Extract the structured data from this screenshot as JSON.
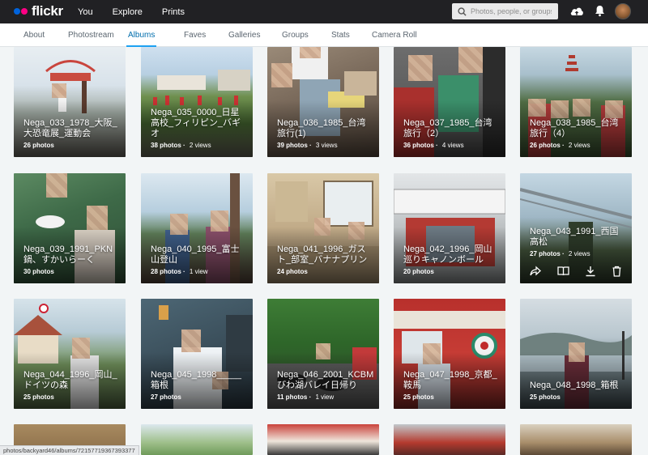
{
  "header": {
    "logo_text": "flickr",
    "nav": [
      "You",
      "Explore",
      "Prints"
    ],
    "search_placeholder": "Photos, people, or groups"
  },
  "subnav": {
    "tabs": [
      "About",
      "Photostream",
      "Albums",
      "Faves",
      "Galleries",
      "Groups",
      "Stats",
      "Camera Roll"
    ],
    "active": "Albums"
  },
  "albums": [
    {
      "title": "Nega_033_1978_大阪_大恐竜展_運動会",
      "photos": "26 photos",
      "views": ""
    },
    {
      "title": "Nega_035_0000_日星高校_フィリピン_バギオ",
      "photos": "38 photos",
      "views": "2 views"
    },
    {
      "title": "Nega_036_1985_台湾旅行(1)",
      "photos": "39 photos",
      "views": "3 views"
    },
    {
      "title": "Nega_037_1985_台湾旅行（2）",
      "photos": "36 photos",
      "views": "4 views"
    },
    {
      "title": "Nega_038_1985_台湾旅行（4）",
      "photos": "26 photos",
      "views": "2 views"
    },
    {
      "title": "Nega_039_1991_PKN鍋、すかいらーく",
      "photos": "30 photos",
      "views": ""
    },
    {
      "title": "Nega_040_1995_富士山登山",
      "photos": "28 photos",
      "views": "1 view"
    },
    {
      "title": "Nega_041_1996_ガスト_部室_バナナプリン",
      "photos": "24 photos",
      "views": ""
    },
    {
      "title": "Nega_042_1996_岡山巡りキャノンボール",
      "photos": "20 photos",
      "views": ""
    },
    {
      "title": "Nega_043_1991_西国高松",
      "photos": "27 photos",
      "views": "2 views"
    },
    {
      "title": "Nega_044_1996_岡山_ドイツの森",
      "photos": "25 photos",
      "views": ""
    },
    {
      "title": "Nega_045_1998_____箱根",
      "photos": "27 photos",
      "views": ""
    },
    {
      "title": "Nega_046_2001_KCBMびわ湖バレイ日帰り",
      "photos": "11 photos",
      "views": "1 view"
    },
    {
      "title": "Nega_047_1998_京都_鞍馬",
      "photos": "25 photos",
      "views": ""
    },
    {
      "title": "Nega_048_1998_箱根",
      "photos": "25 photos",
      "views": ""
    }
  ],
  "status_url": "photos/backyard46/albums/72157719367393377"
}
